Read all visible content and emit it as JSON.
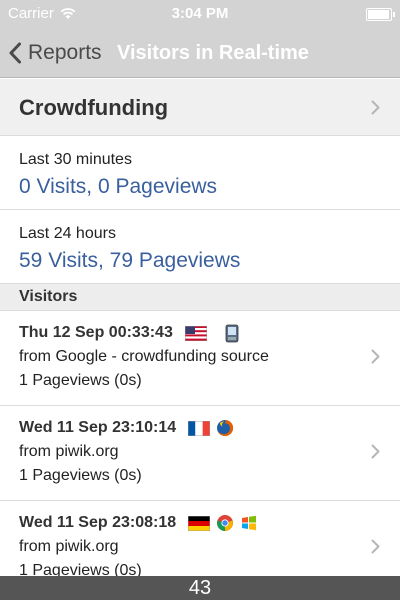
{
  "status_bar": {
    "carrier": "Carrier",
    "time": "3:04 PM",
    "wifi_icon": "wifi-icon",
    "battery_icon": "battery-icon",
    "battery_level": 1.0
  },
  "nav": {
    "back_label": "Reports",
    "back_icon": "chevron-left-icon",
    "title": "Visitors in Real-time"
  },
  "site": {
    "name": "Crowdfunding"
  },
  "stats": [
    {
      "label": "Last 30 minutes",
      "value": "0 Visits, 0 Pageviews"
    },
    {
      "label": "Last 24 hours",
      "value": "59 Visits, 79 Pageviews"
    }
  ],
  "section": {
    "title": "Visitors"
  },
  "visitors": [
    {
      "time": "Thu 12 Sep 00:33:43",
      "referrer": "from Google - crowdfunding source",
      "pageviews": "1 Pageviews (0s)",
      "icons": [
        "flag-us-icon",
        "mobile-phone-icon"
      ]
    },
    {
      "time": "Wed 11 Sep 23:10:14",
      "referrer": "from piwik.org",
      "pageviews": "1 Pageviews (0s)",
      "icons": [
        "flag-fr-icon",
        "firefox-icon"
      ]
    },
    {
      "time": "Wed 11 Sep 23:08:18",
      "referrer": "from piwik.org",
      "pageviews": "1 Pageviews (0s)",
      "icons": [
        "flag-de-icon",
        "chrome-icon",
        "windows-icon"
      ]
    }
  ],
  "footer": {
    "count": "43"
  },
  "colors": {
    "bar_bg": "#d3d3d3",
    "link_blue": "#3a5f9e",
    "footer_bg": "#555555"
  }
}
